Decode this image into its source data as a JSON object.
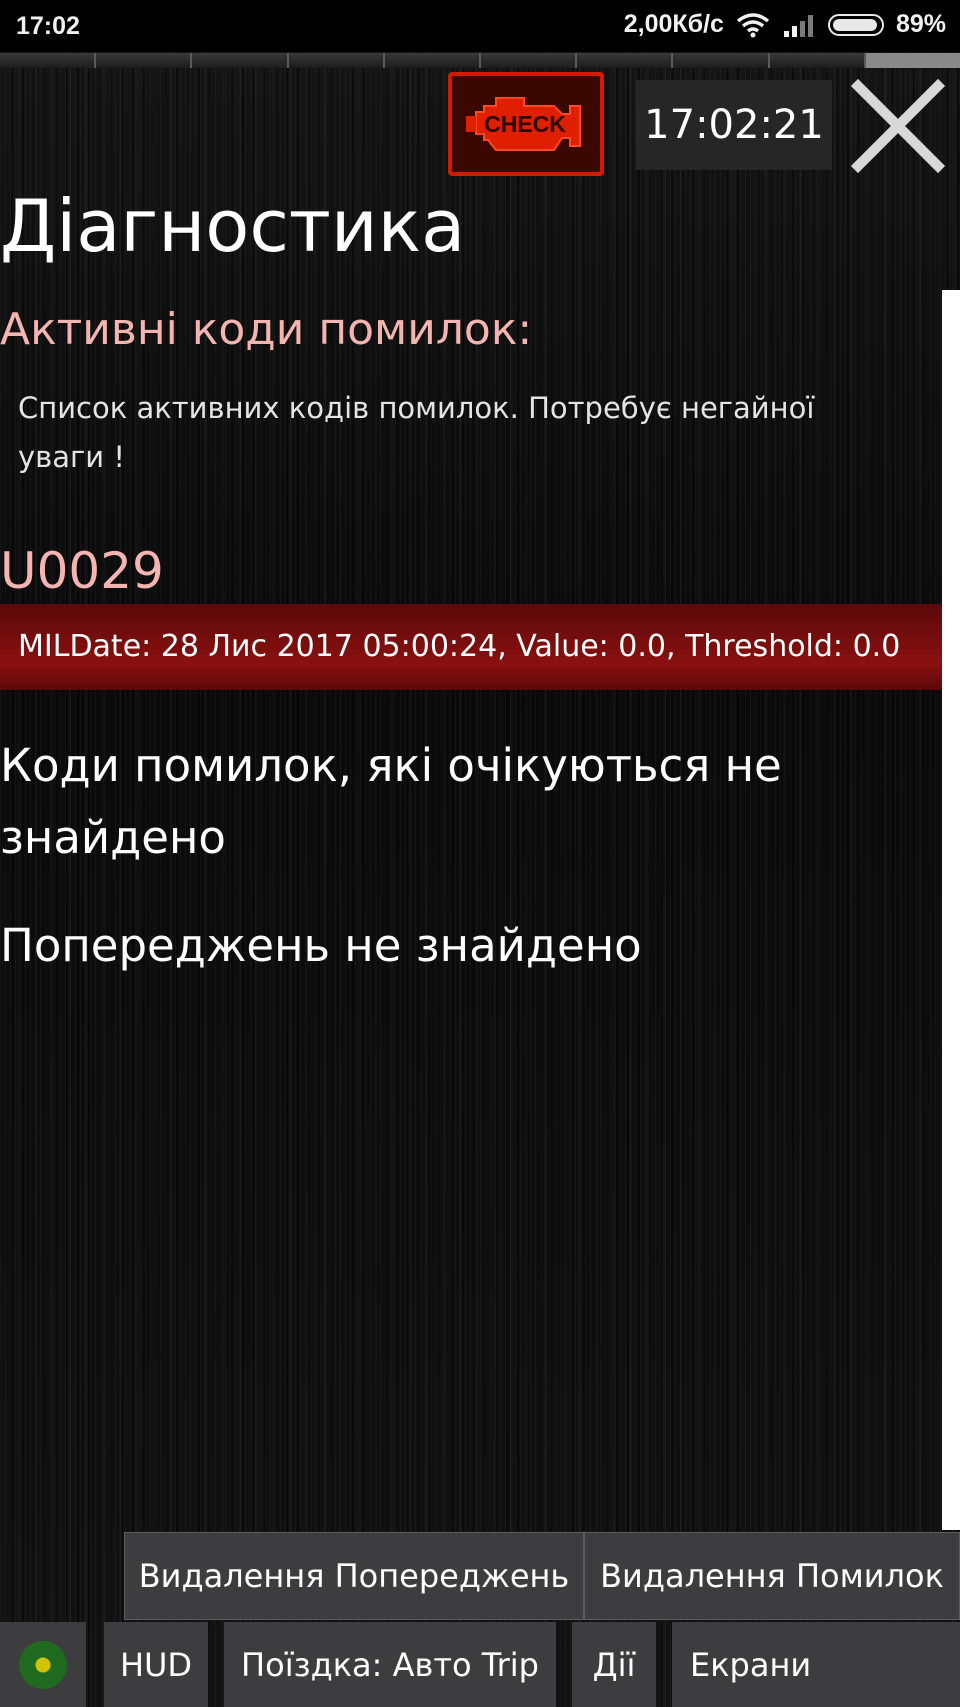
{
  "status_bar": {
    "time": "17:02",
    "network_speed": "2,00Кб/с",
    "battery": "89%",
    "icons": [
      "wifi-icon",
      "signal-icon",
      "battery-icon"
    ]
  },
  "header": {
    "check_engine_label": "CHECK",
    "clock": "17:02:21",
    "close_icon": "close-icon"
  },
  "page": {
    "title": "Діагностика",
    "active_codes_title": "Активні коди помилок:",
    "active_codes_description": "Список активних кодів помилок. Потребує негайної уваги !",
    "codes": [
      {
        "code": "U0029",
        "details": "MILDate: 28 Лис 2017 05:00:24, Value: 0.0, Threshold: 0.0"
      }
    ],
    "pending_message": "Коди помилок, які очікуються не знайдено",
    "warnings_message": "Попереджень не знайдено"
  },
  "actions": {
    "delete_warnings": "Видалення Попереджень",
    "delete_errors": "Видалення Помилок"
  },
  "nav": {
    "hud": "HUD",
    "trip": "Поїздка: Авто Trip",
    "actions": "Дії",
    "screens": "Екрани"
  },
  "colors": {
    "accent_pink": "#f4b4b0",
    "error_row_red": "#7a0e0e",
    "check_engine_red": "#d11a00",
    "button_gray": "#3d3d40",
    "connection_green": "#1f6a1f",
    "connection_yellow": "#d4c400"
  }
}
